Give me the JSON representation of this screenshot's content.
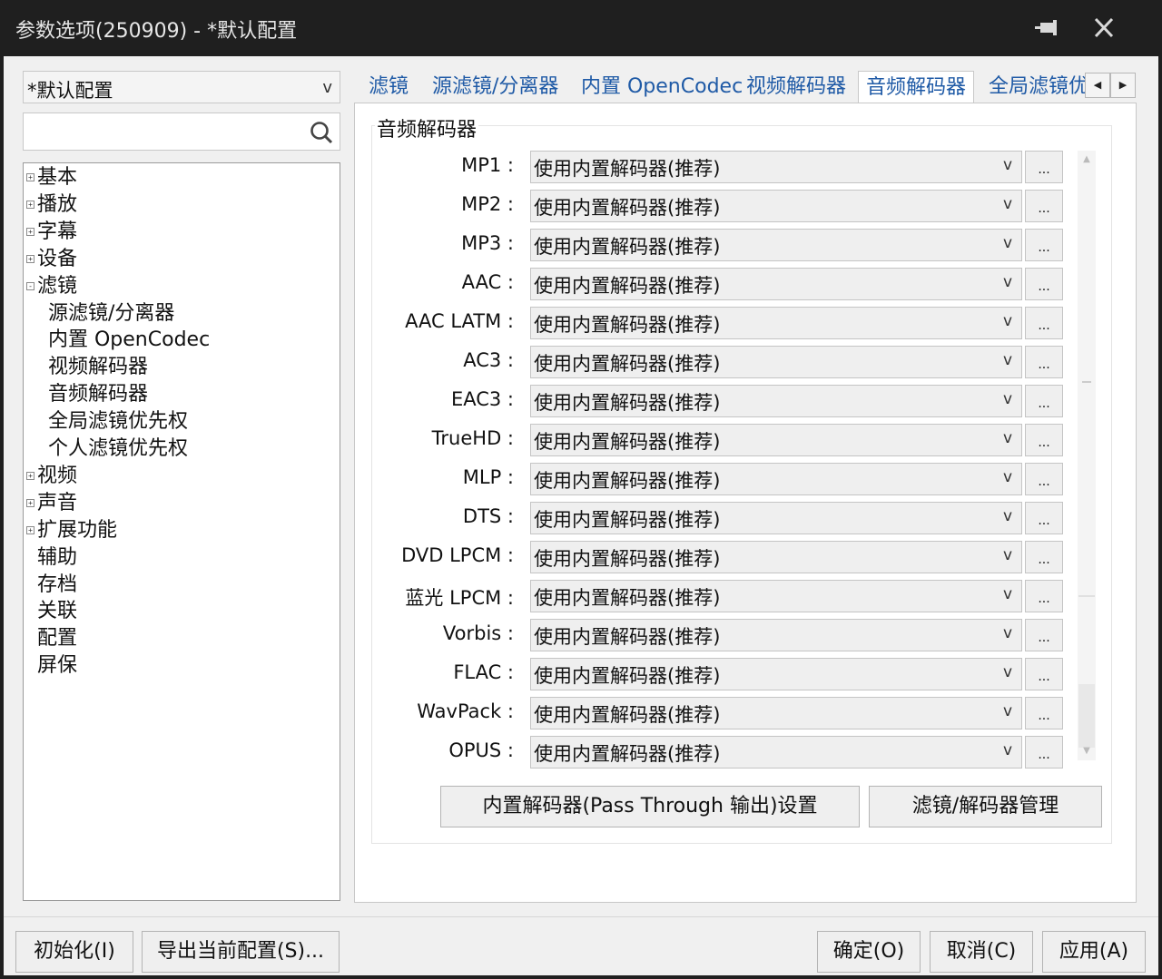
{
  "window": {
    "title": "参数选项(250909) - *默认配置"
  },
  "titlebar_icons": [
    "pin-icon",
    "close-icon"
  ],
  "profile_combo": {
    "value": "*默认配置",
    "arrow": "v"
  },
  "search": {
    "value": "",
    "placeholder": ""
  },
  "tree": {
    "items": [
      {
        "label": "基本",
        "expander": "+"
      },
      {
        "label": "播放",
        "expander": "+"
      },
      {
        "label": "字幕",
        "expander": "+"
      },
      {
        "label": "设备",
        "expander": "+"
      },
      {
        "label": "滤镜",
        "expander": "-"
      },
      {
        "label": "源滤镜/分离器",
        "expander": ""
      },
      {
        "label": "内置 OpenCodec",
        "expander": ""
      },
      {
        "label": "视频解码器",
        "expander": ""
      },
      {
        "label": "音频解码器",
        "expander": ""
      },
      {
        "label": "全局滤镜优先权",
        "expander": ""
      },
      {
        "label": "个人滤镜优先权",
        "expander": ""
      },
      {
        "label": "视频",
        "expander": "+"
      },
      {
        "label": "声音",
        "expander": "+"
      },
      {
        "label": "扩展功能",
        "expander": "+"
      },
      {
        "label": "辅助",
        "expander": ""
      },
      {
        "label": "存档",
        "expander": ""
      },
      {
        "label": "关联",
        "expander": ""
      },
      {
        "label": "配置",
        "expander": ""
      },
      {
        "label": "屏保",
        "expander": ""
      }
    ]
  },
  "tabs": {
    "items": [
      {
        "label": "滤镜"
      },
      {
        "label": "源滤镜/分离器"
      },
      {
        "label": "内置 OpenCodec"
      },
      {
        "label": "视频解码器"
      },
      {
        "label": "音频解码器"
      },
      {
        "label": "全局滤镜优先权"
      }
    ],
    "active": "音频解码器",
    "scroll_left": "◀",
    "scroll_right": "▶"
  },
  "panel": {
    "group_title": "音频解码器",
    "rows": [
      {
        "label": "MP1 :",
        "value": "使用内置解码器(推荐)"
      },
      {
        "label": "MP2 :",
        "value": "使用内置解码器(推荐)"
      },
      {
        "label": "MP3 :",
        "value": "使用内置解码器(推荐)"
      },
      {
        "label": "AAC :",
        "value": "使用内置解码器(推荐)"
      },
      {
        "label": "AAC LATM :",
        "value": "使用内置解码器(推荐)"
      },
      {
        "label": "AC3 :",
        "value": "使用内置解码器(推荐)"
      },
      {
        "label": "EAC3 :",
        "value": "使用内置解码器(推荐)"
      },
      {
        "label": "TrueHD :",
        "value": "使用内置解码器(推荐)"
      },
      {
        "label": "MLP :",
        "value": "使用内置解码器(推荐)"
      },
      {
        "label": "DTS :",
        "value": "使用内置解码器(推荐)"
      },
      {
        "label": "DVD LPCM :",
        "value": "使用内置解码器(推荐)"
      },
      {
        "label": "蓝光 LPCM :",
        "value": "使用内置解码器(推荐)"
      },
      {
        "label": "Vorbis :",
        "value": "使用内置解码器(推荐)"
      },
      {
        "label": "FLAC :",
        "value": "使用内置解码器(推荐)"
      },
      {
        "label": "WavPack :",
        "value": "使用内置解码器(推荐)"
      },
      {
        "label": "OPUS :",
        "value": "使用内置解码器(推荐)"
      }
    ],
    "dropdown_arrow": "v",
    "more_label": "...",
    "scroll_up": "▲",
    "scroll_down": "▼",
    "passthrough_button": "内置解码器(Pass Through 输出)设置",
    "manager_button": "滤镜/解码器管理"
  },
  "footer": {
    "init_button": "初始化(I)",
    "export_button": "导出当前配置(S)...",
    "ok_button": "确定(O)",
    "cancel_button": "取消(C)",
    "apply_button": "应用(A)"
  }
}
